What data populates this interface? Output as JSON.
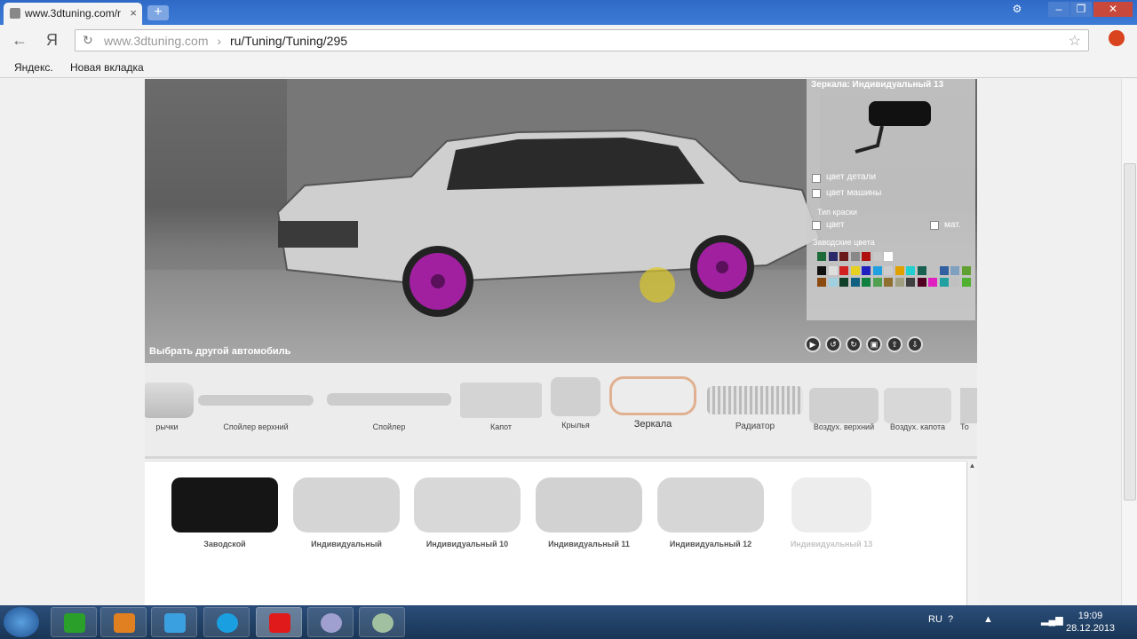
{
  "browser": {
    "tab_title": "www.3dtuning.com/r",
    "close_tab": "×",
    "new_tab": "+",
    "nav_back": "←",
    "yandex_btn": "Я",
    "url_host": "www.3dtuning.com",
    "url_sep": "›",
    "url_path": "ru/Tuning/Tuning/295",
    "bookmarks": [
      "Яндекс.",
      "Новая вкладка"
    ]
  },
  "viewer": {
    "selected_part_title": "Зеркала: Индивидуальный 13",
    "checkbox_part_color": "цвет детали",
    "checkbox_car_color": "цвет машины",
    "paint_type_label": "Тип краски",
    "paint_color": "цвет",
    "paint_matte": "мат.",
    "factory_colors_label": "Заводские цвета",
    "choose_other_car": "Выбрать другой автомобиль",
    "swatches_row1": [
      "#1e6b3a",
      "#2a2a6a",
      "#6a1a1a",
      "#888888",
      "#b01010",
      "#c8c8c8",
      "#ffffff"
    ],
    "swatches_row2": [
      "#111111",
      "#dddddd",
      "#d02020",
      "#e8d020",
      "#2020c0",
      "#20a0e0",
      "#cccccc",
      "#e0a000",
      "#20d0d0",
      "#1a6050",
      "#c0c0c0",
      "#3060a0",
      "#80a0c0",
      "#60a030"
    ],
    "swatches_row3": [
      "#8a4a10",
      "#a0d0e0",
      "#10402a",
      "#106080",
      "#108040",
      "#50a050",
      "#907030",
      "#a0a080",
      "#404040",
      "#500020",
      "#e020c0",
      "#20a0a0",
      "#c0c0c0",
      "#50b030"
    ]
  },
  "parts_strip": [
    {
      "name": "рычки"
    },
    {
      "name": "Спойлер верхний"
    },
    {
      "name": "Спойлер"
    },
    {
      "name": "Капот"
    },
    {
      "name": "Крылья"
    },
    {
      "name": "Зеркала"
    },
    {
      "name": "Радиатор"
    },
    {
      "name": "Воздух. верхний"
    },
    {
      "name": "Воздух. капота"
    },
    {
      "name": "То"
    }
  ],
  "mirror_options": [
    {
      "name": "Заводской"
    },
    {
      "name": "Индивидуальный"
    },
    {
      "name": "Индивидуальный 10"
    },
    {
      "name": "Индивидуальный 11"
    },
    {
      "name": "Индивидуальный 12"
    },
    {
      "name": "Индивидуальный 13"
    }
  ],
  "taskbar": {
    "lang": "RU",
    "time": "19:09",
    "date": "28.12.2013"
  }
}
